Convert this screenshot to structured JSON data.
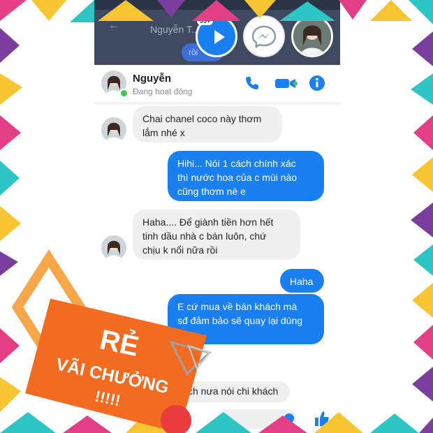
{
  "chat_heads": {
    "unread_badge": "99+"
  },
  "background_thread": {
    "contact_name": "Nguyễn T...",
    "partial_bubble": "rồi"
  },
  "header": {
    "contact_name": "Nguyễn",
    "status": "Đang hoạt động"
  },
  "messages": [
    {
      "from": "contact",
      "text": "Chai chanel coco này thơm\nlắm nhé x"
    },
    {
      "from": "me",
      "text": "Hihi... Nói 1 cách chính xác\nthì nước hoa của c mùi nào\ncũng thơm nè e"
    },
    {
      "from": "contact",
      "text": "Haha.... Để giành tiền hơn hết\ntinh dầu nhà c bán luôn, chứ\nchịu k nổi nữa rồi"
    },
    {
      "from": "me",
      "text": "Haha"
    },
    {
      "from": "me",
      "text": "E cứ mua về bán khách mà\nsđ đảm bảo sẽ quay lại dùng\nle"
    },
    {
      "from": "contact",
      "text": "ch nưa nói chi khách"
    }
  ],
  "promo": {
    "line1": "RẺ",
    "line2": "VÃI CHƯỞNG",
    "line3": "!!!!!"
  },
  "colors": {
    "accent_blue": "#1a80ef",
    "incoming_bg": "#f1f0f0",
    "promo_orange": "#f26b21",
    "border_purple": "#7a3e9c",
    "border_yellow": "#f7c531",
    "border_cyan": "#2ec5c5",
    "border_pink": "#e33f86"
  },
  "icons": [
    "play-icon",
    "messenger-icon",
    "phone-icon",
    "video-camera-icon",
    "info-icon",
    "back-arrow-icon"
  ]
}
